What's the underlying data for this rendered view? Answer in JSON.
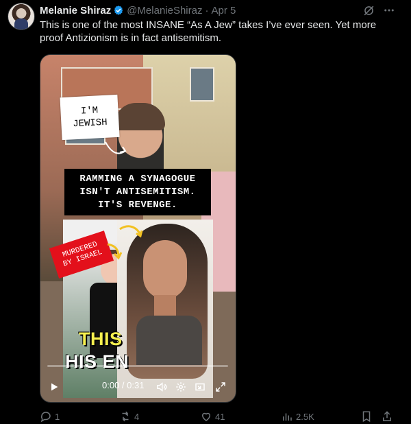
{
  "author": {
    "name": "Melanie Shiraz",
    "handle": "@MelanieShiraz",
    "separator": "·",
    "date": "Apr 5"
  },
  "tweet_text": "This is one of the most INSANE “As A Jew” takes I’ve ever seen. Yet more proof Antizionism is in fact antisemitism.",
  "video": {
    "sticker_top": "I'M\nJEWISH",
    "caption_main": "RAMMING A SYNAGOGUE\nISN'T ANTISEMITISM.\nIT'S REVENGE.",
    "sticker_red": "MURDERED\nBY ISRAEL",
    "overlay_this": "THIS",
    "overlay_his": "HIS EN",
    "time": "0:00 / 0:31",
    "progress": 0
  },
  "actions": {
    "replies": "1",
    "reposts": "4",
    "likes": "41",
    "views": "2.5K"
  },
  "colors": {
    "verified_blue": "#1d9bf0",
    "muted": "#71767b",
    "text": "#e7e9ea"
  }
}
